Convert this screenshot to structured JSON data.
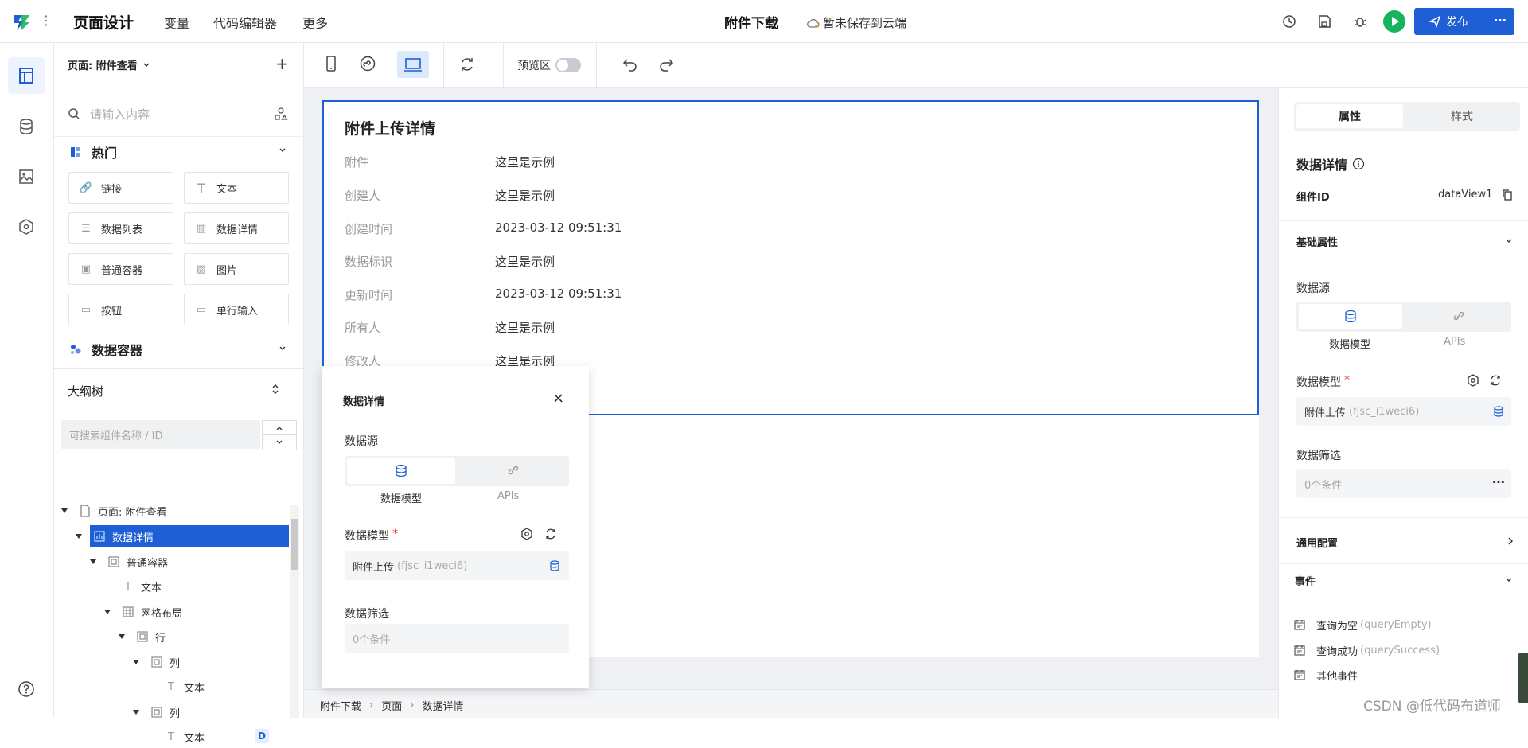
{
  "header": {
    "title": "页面设计",
    "tabs": [
      "变量",
      "代码编辑器",
      "更多"
    ],
    "page_name": "附件下载",
    "save_status": "暂未保存到云端",
    "publish_label": "发布"
  },
  "toolbar": {
    "preview_label": "预览区"
  },
  "left_panel": {
    "page_selector": "页面: 附件查看",
    "search_placeholder": "请输入内容",
    "hot_section": "热门",
    "components": [
      "链接",
      "文本",
      "数据列表",
      "数据详情",
      "普通容器",
      "图片",
      "按钮",
      "单行输入"
    ],
    "data_container_section": "数据容器",
    "outline_title": "大纲树",
    "outline_search_placeholder": "可搜索组件名称 / ID",
    "tree": [
      "页面: 附件查看",
      "数据详情",
      "普通容器",
      "文本",
      "网格布局",
      "行",
      "列",
      "文本",
      "列",
      "文本"
    ],
    "tree_badge": "D"
  },
  "canvas": {
    "card_title": "附件上传详情",
    "rows": [
      {
        "label": "附件",
        "value": "这里是示例"
      },
      {
        "label": "创建人",
        "value": "这里是示例"
      },
      {
        "label": "创建时间",
        "value": "2023-03-12 09:51:31"
      },
      {
        "label": "数据标识",
        "value": "这里是示例"
      },
      {
        "label": "更新时间",
        "value": "2023-03-12 09:51:31"
      },
      {
        "label": "所有人",
        "value": "这里是示例"
      },
      {
        "label": "修改人",
        "value": "这里是示例"
      }
    ],
    "breadcrumb": [
      "附件下载",
      "页面",
      "数据详情"
    ]
  },
  "popup": {
    "title": "数据详情",
    "datasource_label": "数据源",
    "source_options": [
      "数据模型",
      "APIs"
    ],
    "model_label": "数据模型",
    "required_mark": "*",
    "model_value": "附件上传",
    "model_code": "(fjsc_i1weci6)",
    "filter_label": "数据筛选",
    "filter_value": "0个条件"
  },
  "right_panel": {
    "tabs": [
      "属性",
      "样式"
    ],
    "component_title": "数据详情",
    "component_id_label": "组件ID",
    "component_id_value": "dataView1",
    "basic_section": "基础属性",
    "datasource_label": "数据源",
    "source_options": [
      "数据模型",
      "APIs"
    ],
    "model_label": "数据模型",
    "required_mark": "*",
    "model_value": "附件上传",
    "model_code": "(fjsc_i1weci6)",
    "filter_label": "数据筛选",
    "filter_value": "0个条件",
    "general_section": "通用配置",
    "events_section": "事件",
    "events": [
      {
        "name": "查询为空",
        "code": "(queryEmpty)"
      },
      {
        "name": "查询成功",
        "code": "(querySuccess)"
      },
      {
        "name": "其他事件",
        "code": ""
      }
    ]
  },
  "watermark": "CSDN @低代码布道师",
  "colors": {
    "accent": "#1f5fd6",
    "play": "#19b35e"
  }
}
